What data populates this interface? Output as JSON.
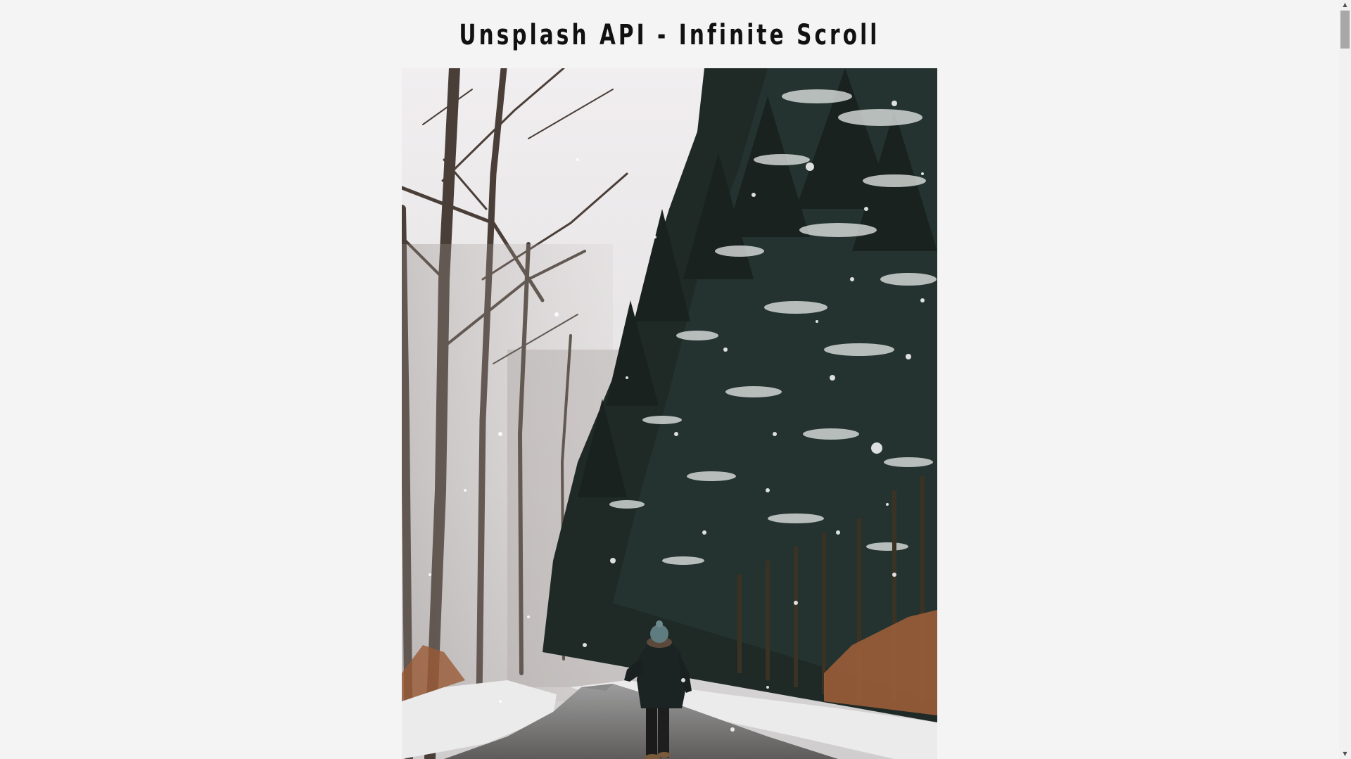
{
  "page": {
    "title": "Unsplash API - Infinite Scroll",
    "background_color": "#f4f4f4"
  },
  "gallery": {
    "images": [
      {
        "content": "snowy forest road with a person in a dark jacket and teal beanie walking away"
      }
    ]
  },
  "scrollbar": {
    "up_icon": "triangle-up-icon",
    "down_icon": "triangle-down-icon",
    "position": 0
  }
}
